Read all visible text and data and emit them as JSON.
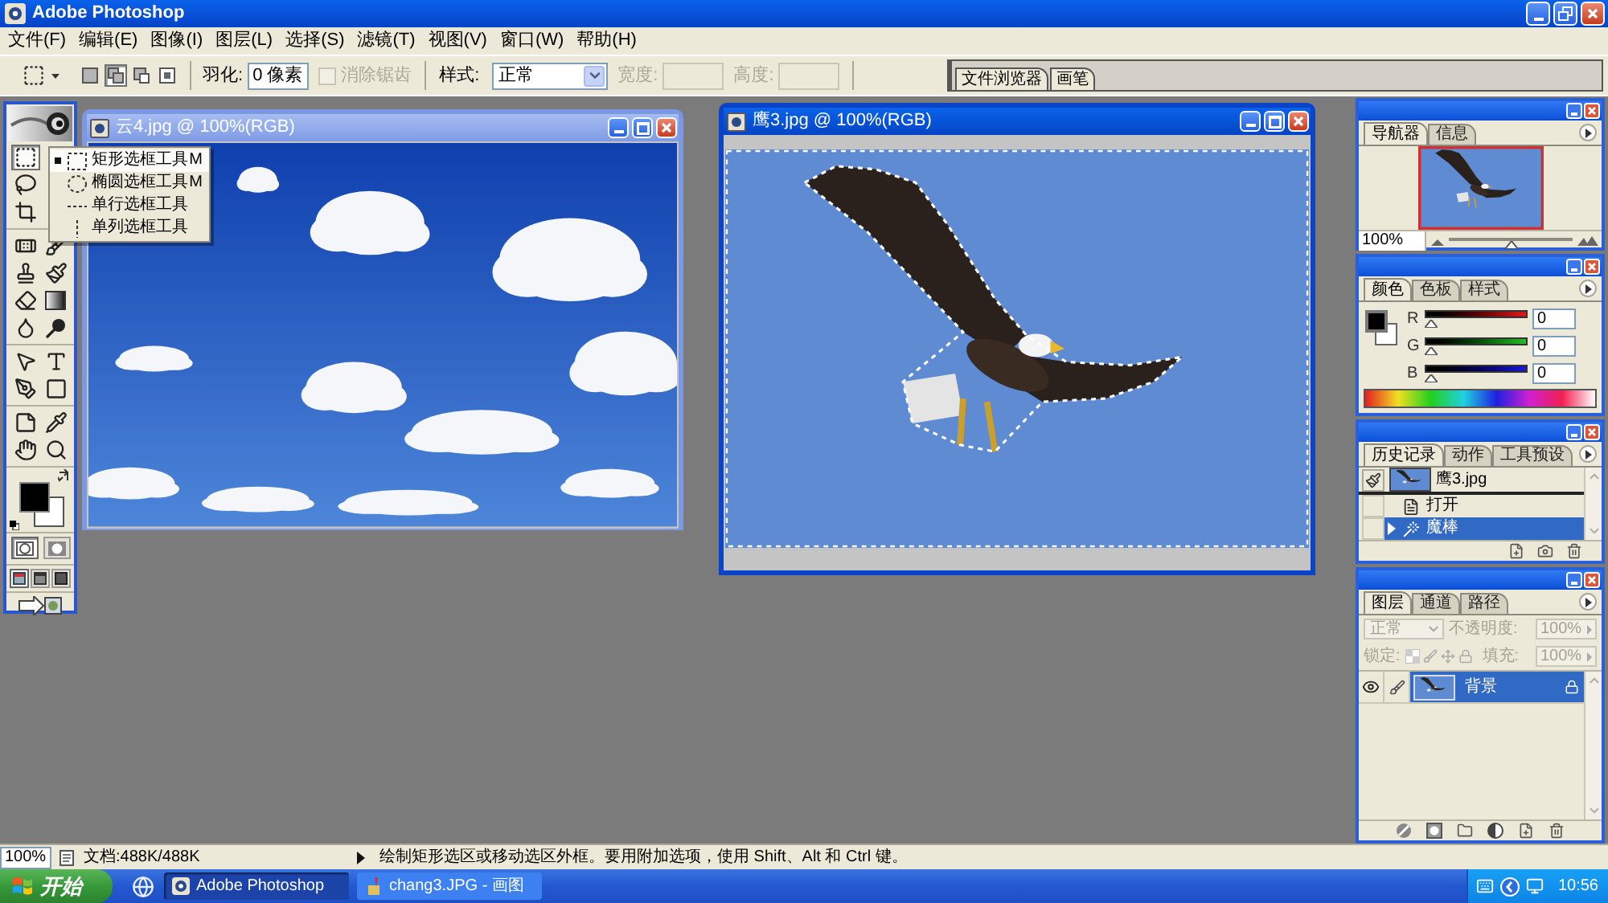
{
  "app_window": {
    "title": "Adobe Photoshop"
  },
  "menu": [
    "文件(F)",
    "编辑(E)",
    "图像(I)",
    "图层(L)",
    "选择(S)",
    "滤镜(T)",
    "视图(V)",
    "窗口(W)",
    "帮助(H)"
  ],
  "options_bar": {
    "selection_modes": [
      {
        "kind": "new",
        "selected": false
      },
      {
        "kind": "add",
        "selected": true
      },
      {
        "kind": "subtract",
        "selected": false
      },
      {
        "kind": "intersect",
        "selected": false
      }
    ],
    "feather": {
      "label": "羽化:",
      "value": "0 像素"
    },
    "anti_alias": {
      "label": "消除锯齿",
      "checked": false,
      "disabled": true
    },
    "style": {
      "label": "样式:",
      "value": "正常"
    },
    "width": {
      "label": "宽度:",
      "disabled": true
    },
    "height": {
      "label": "高度:",
      "disabled": true
    }
  },
  "palette_well": {
    "tabs": [
      "文件浏览器",
      "画笔"
    ]
  },
  "toolbox": {
    "groups": [
      [
        [
          {
            "kind": "marquee",
            "selected": true
          }
        ],
        [
          {
            "kind": "lasso",
            "selected": false
          }
        ],
        [
          {
            "kind": "crop",
            "selected": false
          }
        ]
      ],
      [
        [
          {
            "kind": "healing",
            "selected": false
          },
          {
            "kind": "brush",
            "selected": false
          }
        ],
        [
          {
            "kind": "stamp",
            "selected": false
          },
          {
            "kind": "history-brush",
            "selected": false
          }
        ],
        [
          {
            "kind": "eraser",
            "selected": false
          },
          {
            "kind": "gradient",
            "selected": false
          }
        ],
        [
          {
            "kind": "blur",
            "selected": false
          },
          {
            "kind": "dodge",
            "selected": false
          }
        ]
      ],
      [
        [
          {
            "kind": "path-select",
            "selected": false
          },
          {
            "kind": "type",
            "selected": false
          }
        ],
        [
          {
            "kind": "pen",
            "selected": false
          },
          {
            "kind": "shape",
            "selected": false
          }
        ]
      ],
      [
        [
          {
            "kind": "notes",
            "selected": false
          },
          {
            "kind": "eyedropper",
            "selected": false
          }
        ],
        [
          {
            "kind": "hand",
            "selected": false
          },
          {
            "kind": "zoom",
            "selected": false
          }
        ]
      ]
    ],
    "quick_mask_modes": [
      {
        "kind": "standard",
        "selected": true
      },
      {
        "kind": "mask",
        "selected": false
      }
    ],
    "screen_modes": [
      {
        "kind": "window",
        "selected": true
      },
      {
        "kind": "menu",
        "selected": false
      },
      {
        "kind": "full",
        "selected": false
      }
    ]
  },
  "tool_flyout": {
    "items": [
      {
        "kind": "rectangle",
        "label": "矩形选框工具",
        "shortcut": "M",
        "selected": true
      },
      {
        "kind": "ellipse",
        "label": "椭圆选框工具",
        "shortcut": "M",
        "selected": false
      },
      {
        "kind": "row",
        "label": "单行选框工具",
        "selected": false
      },
      {
        "kind": "column",
        "label": "单列选框工具",
        "selected": false
      }
    ]
  },
  "documents": [
    {
      "kind": "sky",
      "title": "云4.jpg @ 100%(RGB)",
      "active": false,
      "selection": false
    },
    {
      "kind": "eagle",
      "title": "鹰3.jpg @ 100%(RGB)",
      "active": true,
      "selection": true
    }
  ],
  "navigator_panel": {
    "tabs": [
      {
        "label": "导航器",
        "selected": true
      },
      {
        "label": "信息",
        "selected": false
      }
    ],
    "zoom": "100%",
    "level": 0.5
  },
  "color_panel": {
    "tabs": [
      {
        "label": "颜色",
        "selected": true
      },
      {
        "label": "色板",
        "selected": false
      },
      {
        "label": "样式",
        "selected": false
      }
    ],
    "channels": [
      {
        "kind": "red",
        "label": "R",
        "value": "0",
        "level": 0
      },
      {
        "kind": "green",
        "label": "G",
        "value": "0",
        "level": 0
      },
      {
        "kind": "blue",
        "label": "B",
        "value": "0",
        "level": 0
      }
    ]
  },
  "history_panel": {
    "tabs": [
      {
        "label": "历史记录",
        "selected": true
      },
      {
        "label": "动作",
        "selected": false
      },
      {
        "label": "工具预设",
        "selected": false
      }
    ],
    "snapshot": "鹰3.jpg",
    "steps": [
      {
        "kind": "open",
        "label": "打开",
        "selected": false
      },
      {
        "kind": "magic-wand",
        "label": "魔棒",
        "selected": true
      }
    ]
  },
  "layers_panel": {
    "tabs": [
      {
        "label": "图层",
        "selected": true
      },
      {
        "label": "通道",
        "selected": false
      },
      {
        "label": "路径",
        "selected": false
      }
    ],
    "controls_disabled": true,
    "blend_mode": "正常",
    "opacity": {
      "label": "不透明度:",
      "value": "100%"
    },
    "lock": {
      "label": "锁定:"
    },
    "fill": {
      "label": "填充:",
      "value": "100%"
    },
    "layers": [
      {
        "name": "背景",
        "visible": true,
        "selected": true,
        "locked": true
      }
    ]
  },
  "status_bar": {
    "zoom": "100%",
    "doc_info": "文档:488K/488K",
    "hint": "绘制矩形选区或移动选区外框。要用附加选项，使用 Shift、Alt 和 Ctrl 键。"
  },
  "taskbar": {
    "start": "开始",
    "tasks": [
      {
        "kind": "photoshop",
        "label": "Adobe Photoshop",
        "active": true
      },
      {
        "kind": "paint",
        "label": "chang3.JPG - 画图",
        "active": false
      }
    ],
    "clock": "10:56"
  }
}
